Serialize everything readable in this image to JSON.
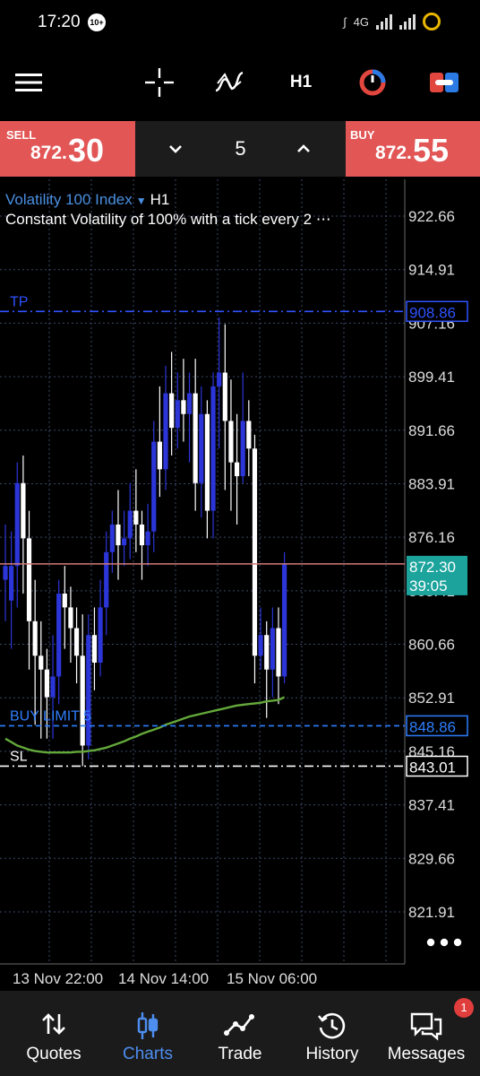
{
  "status_bar": {
    "time": "17:20",
    "notification_badge": "10+",
    "network": "4G"
  },
  "toolbar": {
    "menu_icon": "hamburger-menu-icon",
    "crosshair_icon": "crosshair-icon",
    "indicators_icon": "indicators-icon",
    "timeframe": "H1",
    "color_scheme_icon": "color-scheme-icon",
    "one_click_icon": "one-click-trading-icon"
  },
  "trade_panel": {
    "sell": {
      "label": "SELL",
      "price_prefix": "872.",
      "price_big": "30"
    },
    "buy": {
      "label": "BUY",
      "price_prefix": "872.",
      "price_big": "55"
    },
    "lot": "5",
    "decrease_icon": "chevron-down-icon",
    "increase_icon": "chevron-up-icon"
  },
  "chart": {
    "symbol": "Volatility 100 Index",
    "timeframe": "H1",
    "description": "Constant Volatility of 100% with a tick every 2 ⋯",
    "price_levels": [
      "922.66",
      "914.91",
      "907.16",
      "899.41",
      "891.66",
      "883.91",
      "876.16",
      "868.41",
      "860.66",
      "852.91",
      "845.16",
      "837.41",
      "829.66",
      "821.91"
    ],
    "time_labels": [
      "13 Nov 22:00",
      "14 Nov 14:00",
      "15 Nov 06:00"
    ],
    "current_price": "872.30",
    "countdown": "39:05",
    "tp_label": "TP",
    "tp_price": "908.86",
    "buy_limit_label": "BUY LIMIT 5",
    "buy_limit_price": "848.86",
    "sl_label": "SL",
    "sl_price": "843.01",
    "more_icon": "more-horizontal-icon",
    "colors": {
      "bull": "#2b35d8",
      "bear": "#ffffff",
      "grid": "#3a4868",
      "ma": "#63a83a",
      "bid_line": "#d27c78",
      "tp_line": "#2f52ff",
      "buy_limit_line": "#2e7fff",
      "sl_line": "#ffffff",
      "current_price_bg": "#1ba39c"
    }
  },
  "chart_data": {
    "type": "candlestick",
    "title": "Volatility 100 Index",
    "timeframe": "H1",
    "ylim": [
      819,
      926
    ],
    "y_ticks": [
      922.66,
      914.91,
      907.16,
      899.41,
      891.66,
      883.91,
      876.16,
      868.41,
      860.66,
      852.91,
      845.16,
      837.41,
      829.66,
      821.91
    ],
    "x_tick_labels": [
      "13 Nov 22:00",
      "14 Nov 14:00",
      "15 Nov 06:00"
    ],
    "grid": true,
    "candles": [
      {
        "o": 870,
        "h": 878,
        "c": 872,
        "l": 864
      },
      {
        "o": 867,
        "h": 877,
        "c": 872,
        "l": 860
      },
      {
        "o": 872,
        "h": 887,
        "c": 884,
        "l": 866
      },
      {
        "o": 884,
        "h": 888,
        "c": 876,
        "l": 868
      },
      {
        "o": 876,
        "h": 880,
        "c": 864,
        "l": 857
      },
      {
        "o": 864,
        "h": 870,
        "c": 859,
        "l": 849
      },
      {
        "o": 859,
        "h": 864,
        "c": 857,
        "l": 847
      },
      {
        "o": 857,
        "h": 860,
        "c": 853,
        "l": 847
      },
      {
        "o": 853,
        "h": 862,
        "c": 856,
        "l": 847
      },
      {
        "o": 856,
        "h": 870,
        "c": 868,
        "l": 852
      },
      {
        "o": 868,
        "h": 872,
        "c": 866,
        "l": 860
      },
      {
        "o": 866,
        "h": 869,
        "c": 863,
        "l": 858
      },
      {
        "o": 863,
        "h": 866,
        "c": 859,
        "l": 855
      },
      {
        "o": 859,
        "h": 865,
        "c": 846,
        "l": 843
      },
      {
        "o": 846,
        "h": 865,
        "c": 862,
        "l": 844
      },
      {
        "o": 862,
        "h": 866,
        "c": 858,
        "l": 854
      },
      {
        "o": 858,
        "h": 870,
        "c": 866,
        "l": 856
      },
      {
        "o": 866,
        "h": 877,
        "c": 874,
        "l": 862
      },
      {
        "o": 874,
        "h": 880,
        "c": 878,
        "l": 871
      },
      {
        "o": 878,
        "h": 883,
        "c": 875,
        "l": 870
      },
      {
        "o": 875,
        "h": 880,
        "c": 876,
        "l": 872
      },
      {
        "o": 876,
        "h": 884,
        "c": 880,
        "l": 873
      },
      {
        "o": 880,
        "h": 886,
        "c": 878,
        "l": 874
      },
      {
        "o": 878,
        "h": 880,
        "c": 875,
        "l": 870
      },
      {
        "o": 875,
        "h": 881,
        "c": 877,
        "l": 872
      },
      {
        "o": 877,
        "h": 893,
        "c": 890,
        "l": 874
      },
      {
        "o": 890,
        "h": 898,
        "c": 886,
        "l": 882
      },
      {
        "o": 886,
        "h": 901,
        "c": 897,
        "l": 883
      },
      {
        "o": 897,
        "h": 903,
        "c": 892,
        "l": 888
      },
      {
        "o": 892,
        "h": 900,
        "c": 896,
        "l": 889
      },
      {
        "o": 896,
        "h": 902,
        "c": 894,
        "l": 890
      },
      {
        "o": 894,
        "h": 900,
        "c": 897,
        "l": 887
      },
      {
        "o": 897,
        "h": 902,
        "c": 884,
        "l": 880
      },
      {
        "o": 884,
        "h": 898,
        "c": 894,
        "l": 879
      },
      {
        "o": 894,
        "h": 896,
        "c": 880,
        "l": 876
      },
      {
        "o": 880,
        "h": 900,
        "c": 898,
        "l": 876
      },
      {
        "o": 898,
        "h": 908,
        "c": 900,
        "l": 889
      },
      {
        "o": 900,
        "h": 907,
        "c": 893,
        "l": 883
      },
      {
        "o": 893,
        "h": 899,
        "c": 887,
        "l": 880
      },
      {
        "o": 887,
        "h": 894,
        "c": 885,
        "l": 878
      },
      {
        "o": 885,
        "h": 900,
        "c": 893,
        "l": 884
      },
      {
        "o": 893,
        "h": 896,
        "c": 889,
        "l": 885
      },
      {
        "o": 889,
        "h": 891,
        "c": 859,
        "l": 855
      },
      {
        "o": 859,
        "h": 866,
        "c": 862,
        "l": 857
      },
      {
        "o": 862,
        "h": 864,
        "c": 857,
        "l": 850
      },
      {
        "o": 857,
        "h": 866,
        "c": 863,
        "l": 853
      },
      {
        "o": 863,
        "h": 866,
        "c": 856,
        "l": 852
      },
      {
        "o": 856,
        "h": 874,
        "c": 872.3,
        "l": 855
      }
    ],
    "series": [
      {
        "name": "",
        "type": "moving-average",
        "values": [
          847,
          846.5,
          846,
          845.7,
          845.4,
          845.2,
          845.1,
          845,
          845,
          845,
          845,
          845,
          845.1,
          845.1,
          845.2,
          845.3,
          845.5,
          845.7,
          846,
          846.3,
          846.6,
          847,
          847.3,
          847.7,
          848,
          848.3,
          848.6,
          849,
          849.3,
          849.6,
          849.9,
          850.2,
          850.4,
          850.6,
          850.8,
          851,
          851.2,
          851.4,
          851.6,
          851.8,
          851.9,
          852,
          852.1,
          852.2,
          852.4,
          852.5,
          852.6,
          853
        ]
      }
    ],
    "levels": [
      {
        "label": "TP",
        "value": 908.86
      },
      {
        "label": "BUY LIMIT 5",
        "value": 848.86
      },
      {
        "label": "SL",
        "value": 843.01
      }
    ],
    "current_price": 872.3
  },
  "nav": {
    "items": [
      {
        "label": "Quotes",
        "icon": "quotes-icon"
      },
      {
        "label": "Charts",
        "icon": "charts-icon",
        "active": true
      },
      {
        "label": "Trade",
        "icon": "trade-icon"
      },
      {
        "label": "History",
        "icon": "history-icon"
      },
      {
        "label": "Messages",
        "icon": "messages-icon",
        "badge": "1"
      }
    ]
  }
}
